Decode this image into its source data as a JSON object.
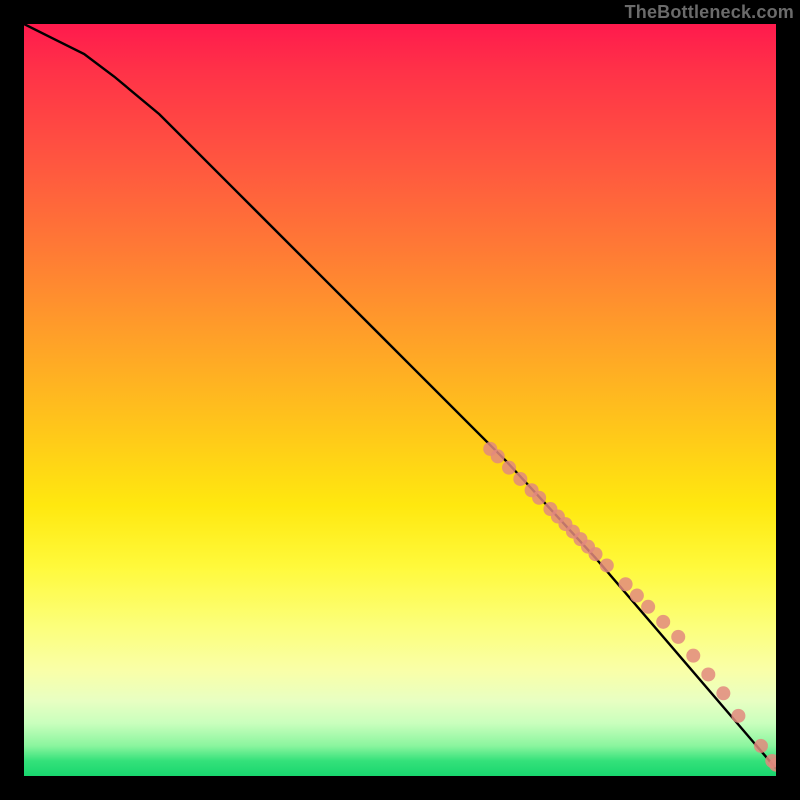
{
  "attribution": "TheBottleneck.com",
  "colors": {
    "page_bg": "#000000",
    "curve_stroke": "#000000",
    "point_fill": "#e28a7e",
    "gradient_top": "#ff1a4d",
    "gradient_bottom": "#18d66e"
  },
  "chart_data": {
    "type": "line",
    "title": "",
    "xlabel": "",
    "ylabel": "",
    "xlim": [
      0,
      100
    ],
    "ylim": [
      0,
      100
    ],
    "grid": false,
    "series": [
      {
        "name": "curve",
        "kind": "line",
        "x": [
          0,
          4,
          8,
          12,
          18,
          28,
          40,
          52,
          64,
          76,
          88,
          100
        ],
        "y": [
          100,
          98,
          96,
          93,
          88,
          78,
          66,
          54,
          42,
          29,
          15,
          1
        ]
      },
      {
        "name": "points",
        "kind": "scatter",
        "x": [
          62,
          63,
          64.5,
          66,
          67.5,
          68.5,
          70,
          71,
          72,
          73,
          74,
          75,
          76,
          77.5,
          80,
          81.5,
          83,
          85,
          87,
          89,
          91,
          93,
          95,
          98,
          99.5,
          100
        ],
        "y": [
          43.5,
          42.5,
          41,
          39.5,
          38,
          37,
          35.5,
          34.5,
          33.5,
          32.5,
          31.5,
          30.5,
          29.5,
          28,
          25.5,
          24,
          22.5,
          20.5,
          18.5,
          16,
          13.5,
          11,
          8,
          4,
          2,
          1.5
        ]
      }
    ]
  }
}
